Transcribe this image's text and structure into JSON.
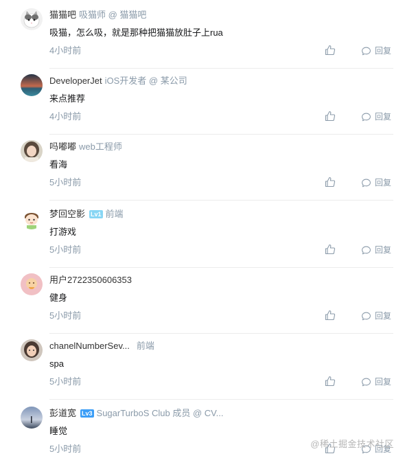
{
  "comments": [
    {
      "username": "猫猫吧",
      "title": "吸猫师 @ 猫猫吧",
      "level": "",
      "content": "吸猫，怎么吸，就是那种把猫猫放肚子上rua",
      "time": "4小时前",
      "reply_label": "回复",
      "avatar_icon": "cat-avatar-icon"
    },
    {
      "username": "DeveloperJet",
      "title": "iOS开发者 @ 某公司",
      "level": "",
      "content": "来点推荐",
      "time": "4小时前",
      "reply_label": "回复",
      "avatar_icon": "sunset-avatar-icon"
    },
    {
      "username": "吗嘟嘟",
      "title": "web工程师",
      "level": "",
      "content": "看海",
      "time": "5小时前",
      "reply_label": "回复",
      "avatar_icon": "girl-avatar-icon"
    },
    {
      "username": "梦回空影",
      "title": "前端",
      "level": "Lv1",
      "content": "打游戏",
      "time": "5小时前",
      "reply_label": "回复",
      "avatar_icon": "cartoon-boy-avatar-icon"
    },
    {
      "username": "用户2722350606353",
      "title": "",
      "level": "",
      "content": "健身",
      "time": "5小时前",
      "reply_label": "回复",
      "avatar_icon": "default-avatar-icon"
    },
    {
      "username": "chanelNumberSev...",
      "title": "前端",
      "level": "",
      "content": "spa",
      "time": "5小时前",
      "reply_label": "回复",
      "avatar_icon": "child-avatar-icon"
    },
    {
      "username": "彭道宽",
      "title": "SugarTurboS Club 成员 @ CV...",
      "level": "Lv3",
      "content": "睡觉",
      "time": "5小时前",
      "reply_label": "回复",
      "avatar_icon": "landscape-avatar-icon"
    }
  ],
  "watermark": "@稀土掘金技术社区",
  "colors": {
    "username": "#333333",
    "meta": "#8a9aa9",
    "content": "#17181a",
    "divider": "#ececec",
    "lv1": "#88d6f4",
    "lv3": "#3c9ef7"
  }
}
